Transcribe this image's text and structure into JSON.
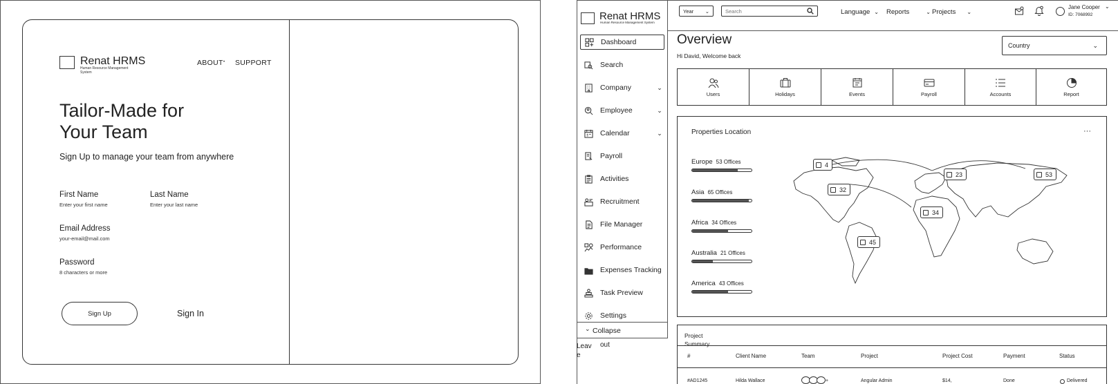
{
  "signup": {
    "brand": "Renat HRMS",
    "brand_sub": "Human Resource Management System",
    "nav": [
      {
        "label": "ABOUT"
      },
      {
        "label": "SUPPORT"
      }
    ],
    "headline_line1": "Tailor-Made for",
    "headline_line2": "Your Team",
    "subhead": "Sign Up to manage your team from anywhere",
    "fields": {
      "first_name": {
        "label": "First Name",
        "placeholder": "Enter your first name"
      },
      "last_name": {
        "label": "Last Name",
        "placeholder": "Enter your last name"
      },
      "email": {
        "label": "Email Address",
        "placeholder": "your-email@mail.com"
      },
      "password": {
        "label": "Password",
        "placeholder": "8 characters or more"
      }
    },
    "signup_label": "Sign Up",
    "signin_label": "Sign In"
  },
  "dashboard": {
    "brand": "Renat HRMS",
    "brand_sub": "Human Resource Management System",
    "sidebar": [
      {
        "label": "Dashboard",
        "icon": "dashboard-icon",
        "active": true,
        "chevron": false
      },
      {
        "label": "Search",
        "icon": "search-icon",
        "active": false,
        "chevron": false
      },
      {
        "label": "Company",
        "icon": "building-icon",
        "active": false,
        "chevron": true
      },
      {
        "label": "Employee",
        "icon": "employee-search-icon",
        "active": false,
        "chevron": true
      },
      {
        "label": "Calendar",
        "icon": "calendar-icon",
        "active": false,
        "chevron": true
      },
      {
        "label": "Payroll",
        "icon": "payroll-icon",
        "active": false,
        "chevron": false
      },
      {
        "label": "Activities",
        "icon": "clipboard-icon",
        "active": false,
        "chevron": false
      },
      {
        "label": "Recruitment",
        "icon": "recruitment-icon",
        "active": false,
        "chevron": false
      },
      {
        "label": "File Manager",
        "icon": "file-icon",
        "active": false,
        "chevron": false
      },
      {
        "label": "Performance",
        "icon": "performance-icon",
        "active": false,
        "chevron": false
      },
      {
        "label": "Expenses Tracking",
        "icon": "folder-icon",
        "active": false,
        "chevron": false
      },
      {
        "label": "Task Preview",
        "icon": "task-icon",
        "active": false,
        "chevron": false
      },
      {
        "label": "Settings",
        "icon": "gear-icon",
        "active": false,
        "chevron": false
      }
    ],
    "collapse_label": "Collapse",
    "leave_label": "Leave",
    "logout_label": "out",
    "topbar": {
      "year_label": "Year",
      "search_placeholder": "Search",
      "menus": [
        {
          "label": "Language"
        },
        {
          "label": "Reports"
        },
        {
          "label": "Projects"
        }
      ],
      "user_name": "Jane Cooper",
      "user_id": "ID: 7068992"
    },
    "overview_title": "Overview",
    "welcome": "Hi David, Welcome back",
    "country_label": "Country",
    "tiles": [
      {
        "label": "Users",
        "icon": "users-icon"
      },
      {
        "label": "Holidays",
        "icon": "suitcase-icon"
      },
      {
        "label": "Events",
        "icon": "events-icon"
      },
      {
        "label": "Payroll",
        "icon": "card-icon"
      },
      {
        "label": "Accounts",
        "icon": "list-icon"
      },
      {
        "label": "Report",
        "icon": "pie-icon"
      }
    ],
    "map": {
      "title": "Properties Location",
      "more": "···",
      "regions": [
        {
          "name": "Europe",
          "count": "53 Offices",
          "fill": 0.77
        },
        {
          "name": "Asia",
          "count": "65 Offices",
          "fill": 0.95
        },
        {
          "name": "Africa",
          "count": "34 Offices",
          "fill": 0.6
        },
        {
          "name": "Australia",
          "count": "21 Offices",
          "fill": 0.35
        },
        {
          "name": "America",
          "count": "43 Offices",
          "fill": 0.6
        }
      ],
      "pins": [
        "4",
        "23",
        "53",
        "32",
        "34",
        "45"
      ]
    },
    "summary": {
      "title": "Project Summary",
      "columns": [
        "#",
        "Client Name",
        "Team",
        "Project",
        "Project Cost",
        "Payment",
        "Status"
      ],
      "row": [
        "#AD1245",
        "Hilda Wallace",
        "+",
        "Angular Admin",
        "$14,",
        "Done",
        "Delivered"
      ]
    }
  }
}
